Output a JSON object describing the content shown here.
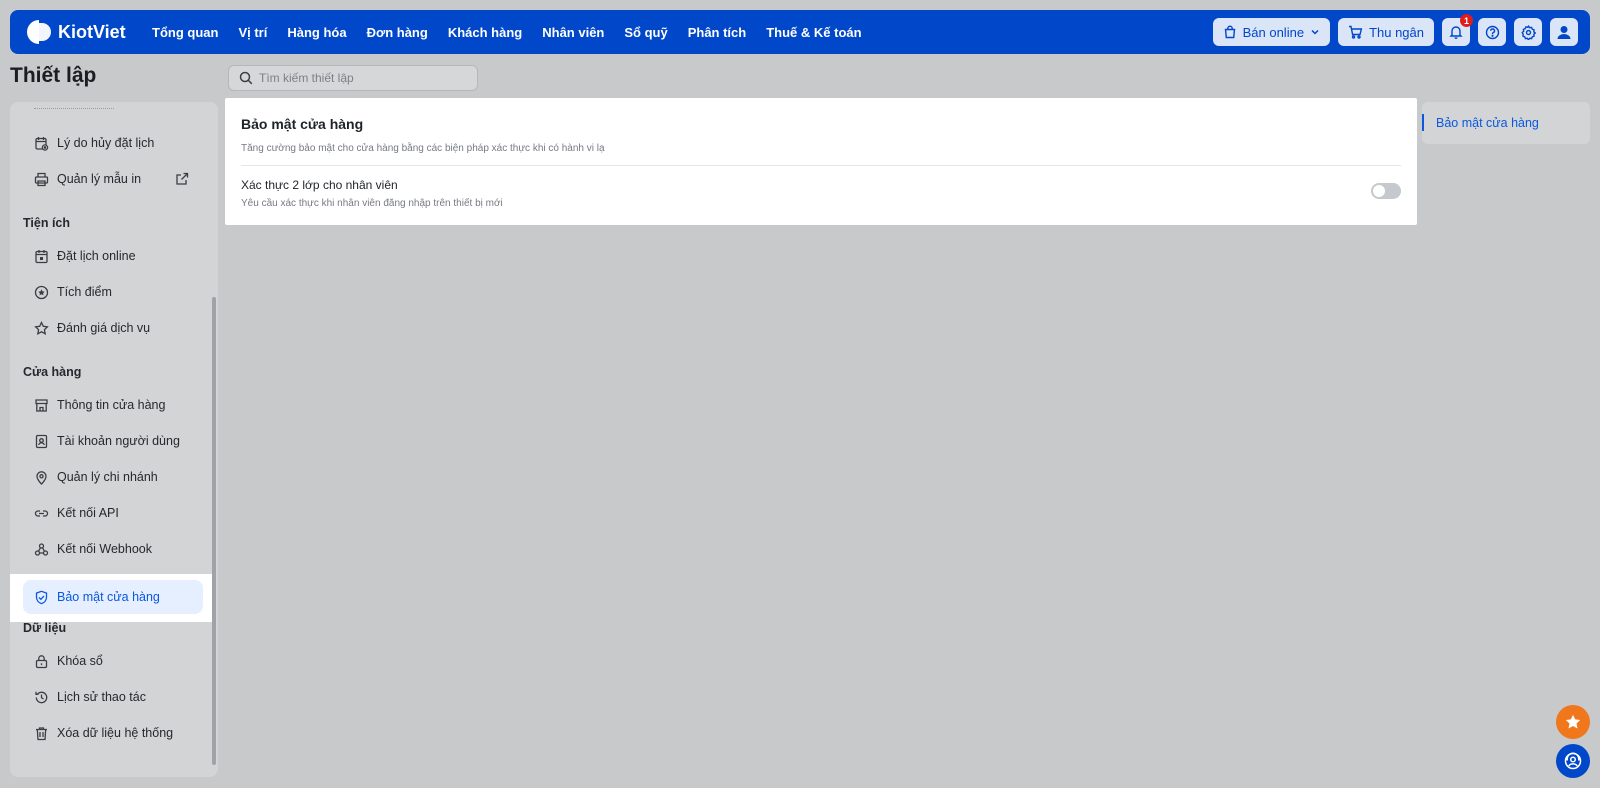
{
  "topbar": {
    "brand": "KiotViet",
    "nav": [
      "Tổng quan",
      "Vị trí",
      "Hàng hóa",
      "Đơn hàng",
      "Khách hàng",
      "Nhân viên",
      "Sổ quỹ",
      "Phân tích",
      "Thuế & Kế toán"
    ],
    "sell_online": "Bán online",
    "cashier": "Thu ngân",
    "notification_count": "1"
  },
  "page": {
    "title": "Thiết lập",
    "search_placeholder": "Tìm kiếm thiết lập"
  },
  "sidebar": {
    "items_top": [
      {
        "label": "Lý do hủy đặt lịch",
        "icon": "calendar-x-icon"
      },
      {
        "label": "Quản lý mẫu in",
        "icon": "printer-icon"
      }
    ],
    "group_utilities": "Tiện ích",
    "utilities": [
      {
        "label": "Đặt lịch online",
        "icon": "calendar-icon"
      },
      {
        "label": "Tích điểm",
        "icon": "points-icon"
      },
      {
        "label": "Đánh giá dịch vụ",
        "icon": "star-icon"
      }
    ],
    "group_store": "Cửa hàng",
    "store": [
      {
        "label": "Thông tin cửa hàng",
        "icon": "store-icon"
      },
      {
        "label": "Tài khoản người dùng",
        "icon": "user-account-icon"
      },
      {
        "label": "Quản lý chi nhánh",
        "icon": "location-icon"
      },
      {
        "label": "Kết nối API",
        "icon": "link-icon"
      },
      {
        "label": "Kết nối Webhook",
        "icon": "webhook-icon"
      }
    ],
    "active_item": "Bảo mật cửa hàng",
    "group_data": "Dữ liệu",
    "data": [
      {
        "label": "Khóa sổ",
        "icon": "lock-icon"
      },
      {
        "label": "Lịch sử thao tác",
        "icon": "history-icon"
      },
      {
        "label": "Xóa dữ liệu hệ thống",
        "icon": "trash-icon"
      }
    ]
  },
  "card": {
    "title": "Bảo mật cửa hàng",
    "description": "Tăng cường bảo mật cho cửa hàng bằng các biện pháp xác thực khi có hành vi lạ",
    "option_label": "Xác thực 2 lớp cho nhân viên",
    "option_description": "Yêu cầu xác thực khi nhân viên đăng nhập trên thiết bị mới",
    "option_enabled": false
  },
  "toc": {
    "link": "Bảo mật cửa hàng"
  },
  "colors": {
    "brand": "#0047c9",
    "accent": "#0a58e0",
    "fab_star": "#f0771c"
  }
}
